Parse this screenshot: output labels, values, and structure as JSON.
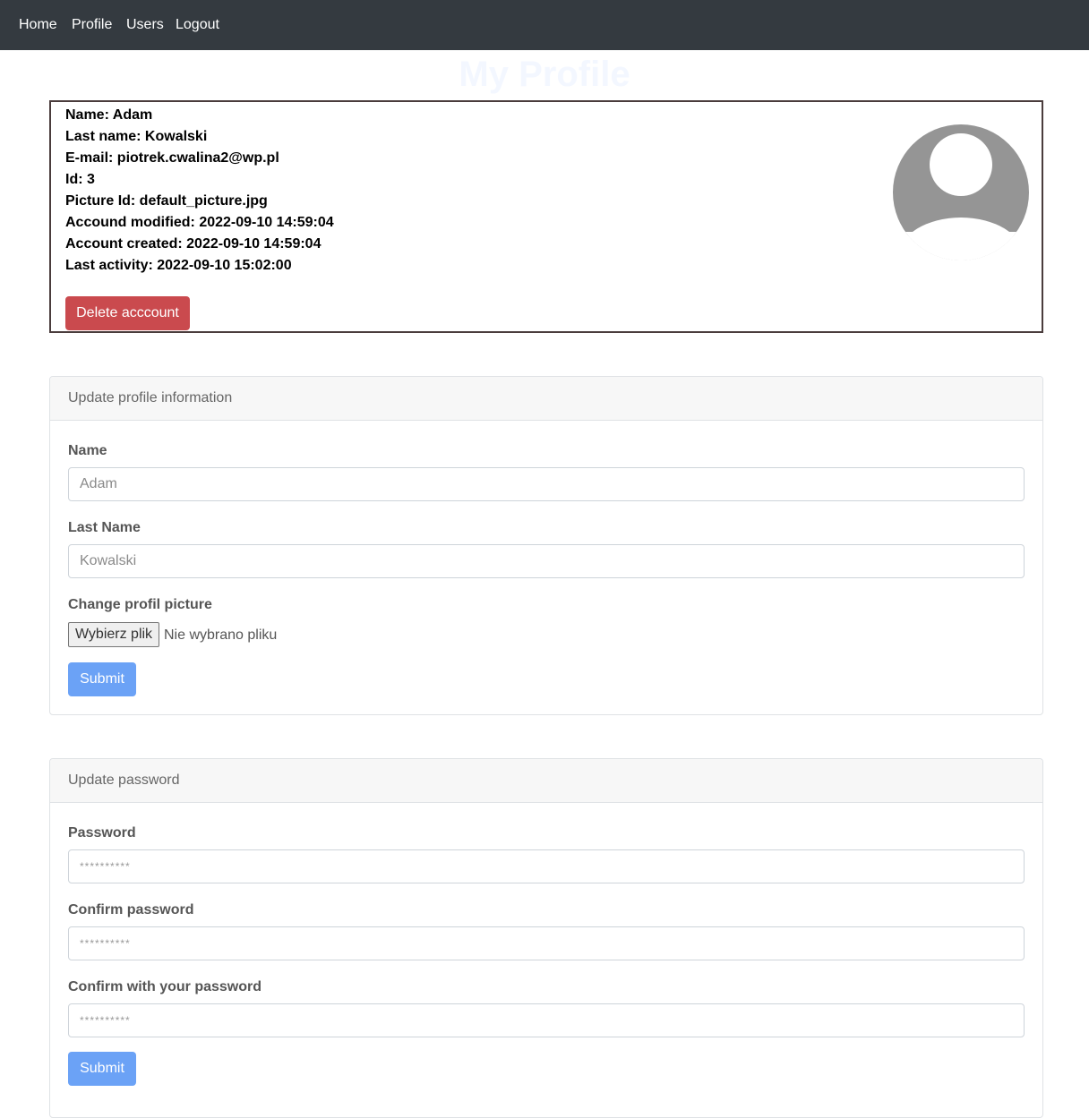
{
  "nav": {
    "items": [
      {
        "label": "Home"
      },
      {
        "label": "Profile"
      },
      {
        "label": "Users"
      },
      {
        "label": "Logout"
      }
    ]
  },
  "page": {
    "title": "My Profile"
  },
  "profile": {
    "name": "Name: Adam",
    "last_name": "Last name: Kowalski",
    "email": "E-mail: piotrek.cwalina2@wp.pl",
    "id": "Id: 3",
    "picture_id": "Picture Id: default_picture.jpg",
    "modified": "Accound modified: 2022-09-10 14:59:04",
    "created": "Account created: 2022-09-10 14:59:04",
    "last_activity": "Last activity: 2022-09-10 15:02:00",
    "avatar_icon": "user-avatar-icon",
    "delete_label": "Delete acccount"
  },
  "update_profile": {
    "title": "Update profile information",
    "name_label": "Name",
    "name_placeholder": "Adam",
    "last_name_label": "Last Name",
    "last_name_placeholder": "Kowalski",
    "picture_label": "Change profil picture",
    "file_button_label": "Wybierz plik",
    "file_status": "Nie wybrano pliku",
    "submit_label": "Submit"
  },
  "update_password": {
    "title": "Update password",
    "password_label": "Password",
    "password_placeholder": "**********",
    "confirm_label": "Confirm password",
    "confirm_placeholder": "**********",
    "current_label": "Confirm with your password",
    "current_placeholder": "**********",
    "submit_label": "Submit"
  },
  "colors": {
    "navbar": "#343a40",
    "danger": "#ca4a4e",
    "primary": "#6ba2f6",
    "avatar": "#959595"
  }
}
